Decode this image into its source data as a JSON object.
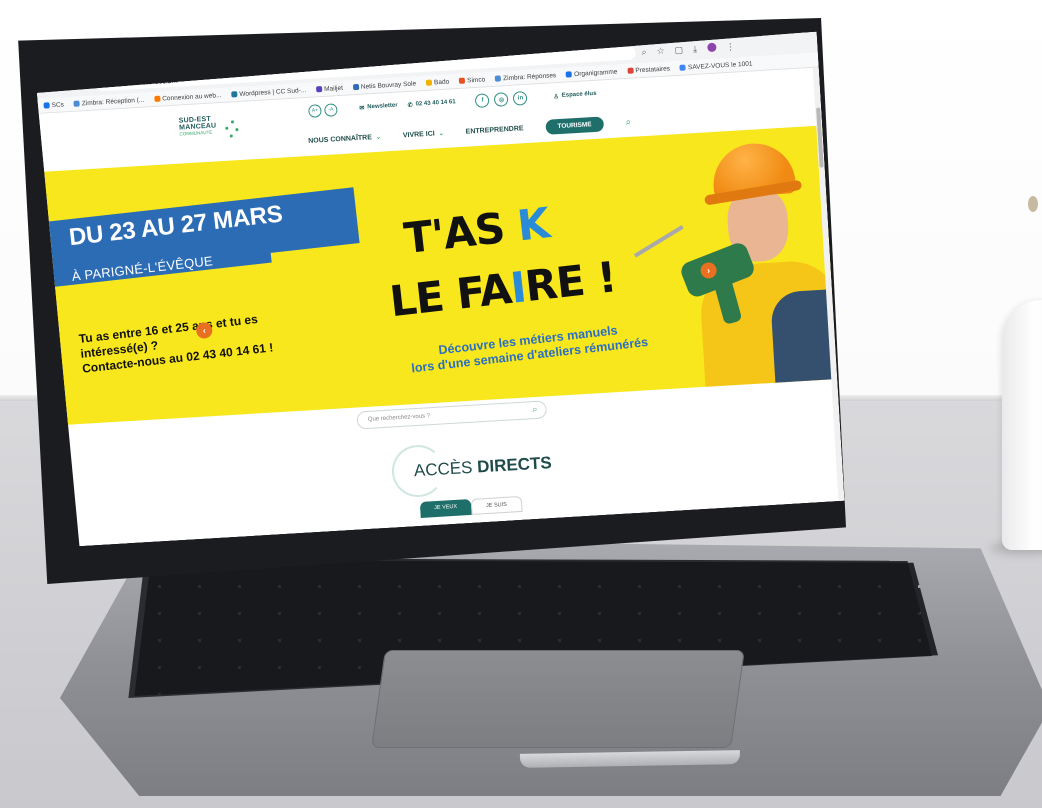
{
  "browser": {
    "url": "cc-sudestmanceau.fr",
    "bookmarks": [
      {
        "label": "SCs",
        "color": "#1a73e8"
      },
      {
        "label": "Zimbra: Réception (...",
        "color": "#4a8cd6"
      },
      {
        "label": "Connexion au web...",
        "color": "#ff7b00"
      },
      {
        "label": "Wordpress | CC Sud-...",
        "color": "#21759b"
      },
      {
        "label": "Mailjet",
        "color": "#5a3fc0"
      },
      {
        "label": "Netis Bouvray Sole",
        "color": "#2f6db5"
      },
      {
        "label": "Bado",
        "color": "#f0b400"
      },
      {
        "label": "Simco",
        "color": "#e8501f"
      },
      {
        "label": "Zimbra: Réponses",
        "color": "#4a8cd6"
      },
      {
        "label": "Organigramme",
        "color": "#1a73e8"
      },
      {
        "label": "Prestataires",
        "color": "#db4437"
      },
      {
        "label": "SAVEZ-VOUS le 1001",
        "color": "#4285f4"
      }
    ]
  },
  "header": {
    "logo_line1": "SUD-EST",
    "logo_line2": "MANCEAU",
    "logo_sub": "COMMUNAUTÉ",
    "font_plus": "A+",
    "font_minus": "-A",
    "news_label": "Newsletter",
    "phone": "02 43 40 14 61",
    "social": [
      "f",
      "◎",
      "in"
    ],
    "espace_label": "Espace élus",
    "nav": [
      {
        "label": "NOUS CONNAÎTRE",
        "has_dropdown": true
      },
      {
        "label": "VIVRE ICI",
        "has_dropdown": true
      },
      {
        "label": "ENTREPRENDRE",
        "has_dropdown": false
      }
    ],
    "tourisme": "TOURISME"
  },
  "hero": {
    "date": "DU 23 AU 27 MARS",
    "place": "À PARIGNÉ-L'ÉVÊQUE",
    "headline_1a": "T'AS ",
    "headline_1b": "K",
    "headline_2a": "LE FA",
    "headline_2b": "I",
    "headline_2c": "RE !",
    "subline_1": "Découvre les métiers manuels",
    "subline_2": "lors d'une semaine d'ateliers rémunérés",
    "left_1": "Tu as entre 16 et 25 ans et tu es",
    "left_2": "intéressé(e) ?",
    "left_3": "Contacte-nous au 02 43 40 14 61 !",
    "prev": "‹",
    "next": "›"
  },
  "search": {
    "placeholder": "Que recherchez-vous ?"
  },
  "acces": {
    "prefix": "ACCÈS ",
    "bold": "DIRECTS"
  },
  "tabs": [
    "JE VEUX",
    "JE SUIS"
  ],
  "colors": {
    "accent": "#1e6f6a",
    "hero_bg": "#f8e71c",
    "banner_blue": "#2b6cb4",
    "orange": "#e8701f"
  }
}
